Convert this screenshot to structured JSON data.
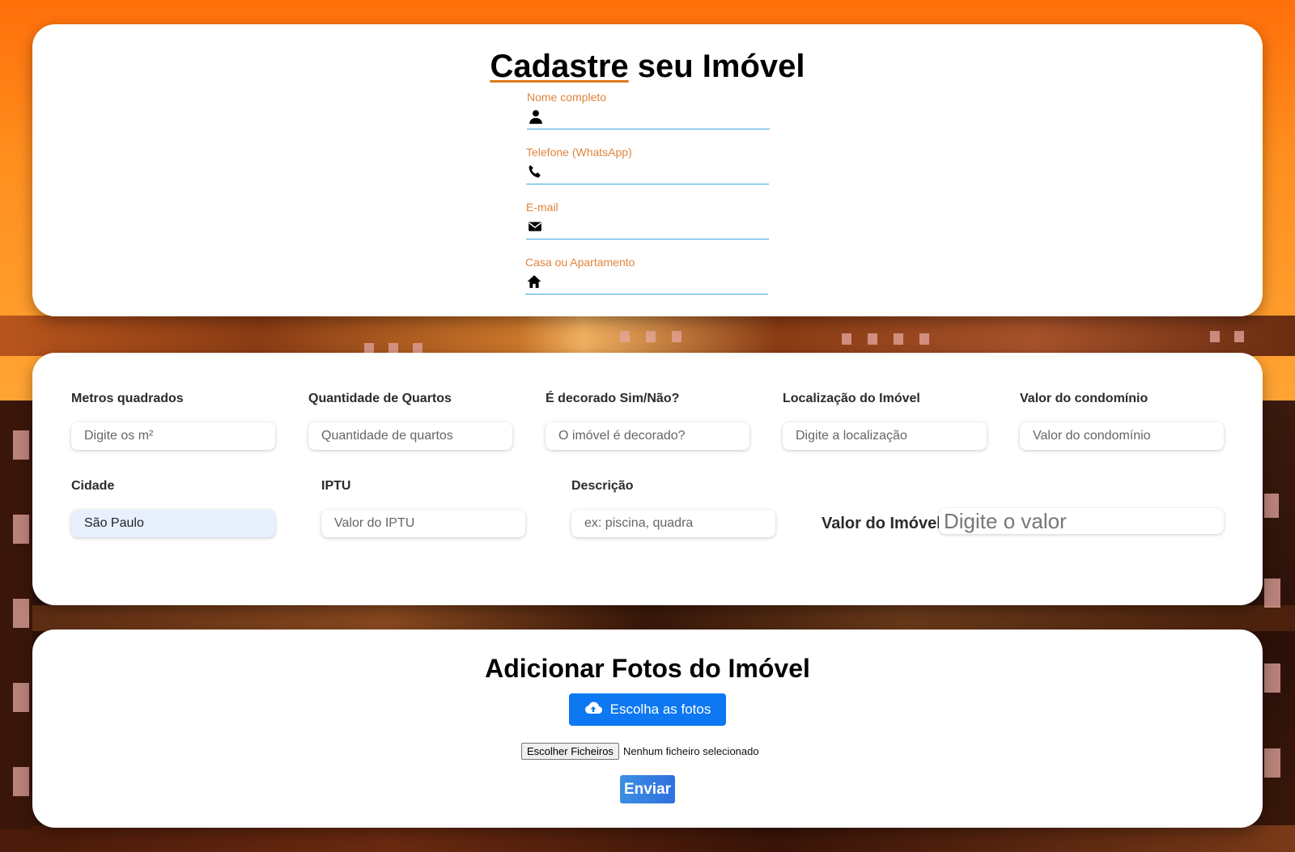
{
  "header": {
    "title_part1": "Cadastre",
    "title_part2": " seu Imóvel"
  },
  "contact_fields": [
    {
      "label": "Nome completo",
      "icon": "user-icon"
    },
    {
      "label": "Telefone (WhatsApp)",
      "icon": "phone-icon"
    },
    {
      "label": "E-mail",
      "icon": "envelope-icon"
    },
    {
      "label": "Casa ou Apartamento",
      "icon": "home-icon"
    }
  ],
  "property": {
    "metros": {
      "label": "Metros quadrados",
      "placeholder": "Digite os m²"
    },
    "quartos": {
      "label": "Quantidade de Quartos",
      "placeholder": "Quantidade de quartos"
    },
    "decorado": {
      "label": "É decorado Sim/Não?",
      "placeholder": "O imóvel é decorado?"
    },
    "localizacao": {
      "label": "Localização do Imóvel",
      "placeholder": "Digite a localização"
    },
    "condominio": {
      "label": "Valor do condomínio",
      "placeholder": "Valor do condomínio"
    },
    "cidade": {
      "label": "Cidade",
      "value": "São Paulo"
    },
    "iptu": {
      "label": "IPTU",
      "placeholder": "Valor do IPTU"
    },
    "descricao": {
      "label": "Descrição",
      "placeholder": "ex: piscina, quadra"
    },
    "valor": {
      "label": "Valor do Imóvel",
      "placeholder": "Digite o valor"
    }
  },
  "photos": {
    "title": "Adicionar Fotos do Imóvel",
    "upload_label": "Escolha as fotos",
    "file_button": "Escolher Ficheiros",
    "file_status": "Nenhum ficheiro selecionado",
    "submit_label": "Enviar"
  },
  "colors": {
    "label_accent": "#e0843c",
    "underline": "#3aa9de",
    "primary_button": "#0d78f2",
    "bg_top": "#ff8f1f"
  }
}
